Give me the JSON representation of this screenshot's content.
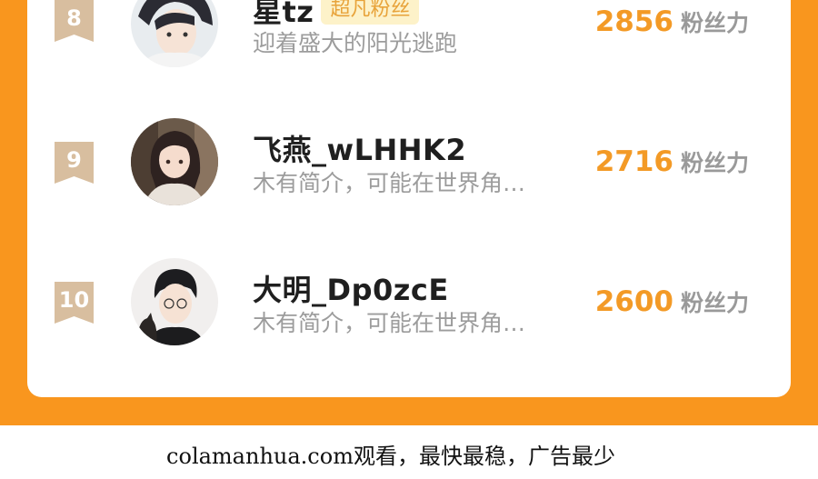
{
  "leaderboard": {
    "rows": [
      {
        "rank": "8",
        "name": "星tz",
        "badge": "超凡粉丝",
        "bio": "迎着盛大的阳光逃跑",
        "score": "2856",
        "score_unit": "粉丝力",
        "avatar": "anime-boy-avatar"
      },
      {
        "rank": "9",
        "name": "飞燕_wLHHK2",
        "bio": "木有简介，可能在世界角…",
        "score": "2716",
        "score_unit": "粉丝力",
        "avatar": "anime-girl-avatar"
      },
      {
        "rank": "10",
        "name": "大明_Dp0zcE",
        "bio": "木有简介，可能在世界角…",
        "score": "2600",
        "score_unit": "粉丝力",
        "avatar": "anime-man-with-cat-avatar"
      }
    ]
  },
  "footer": {
    "text": "colamanhua.com观看，最快最稳，广告最少"
  },
  "colors": {
    "frame_orange": "#F9961E",
    "score_orange": "#F39A26",
    "badge_tan": "#D8BE9F",
    "fan_badge_bg": "#FDF2C9"
  }
}
